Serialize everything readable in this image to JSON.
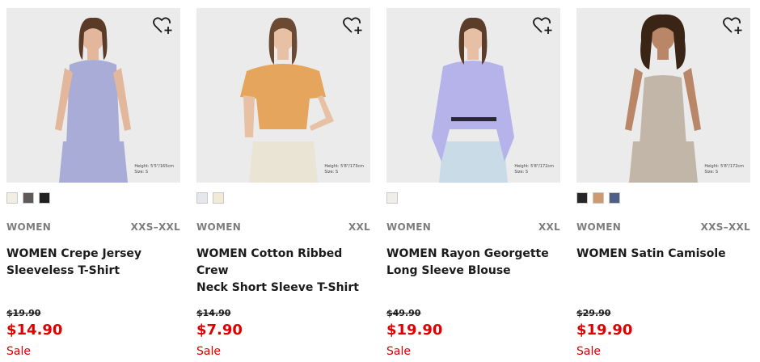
{
  "products": [
    {
      "gender": "WOMEN",
      "size_range": "XXS–XXL",
      "name_lines": [
        "WOMEN Crepe Jersey",
        "Sleeveless T-Shirt"
      ],
      "original_price": "$19.90",
      "price": "$14.90",
      "flag": "Sale",
      "model_info": [
        "Height: 5'5\"/165cm",
        "Size: S"
      ],
      "swatches": [
        "#f1eee6",
        "#5e5a5a",
        "#1f1f1f"
      ],
      "photo": {
        "bg": "#ebebeb",
        "garment": "#a9acd6",
        "pants": "#a9acd6",
        "skin": "#e3b79c",
        "hair": "#5a3b27"
      }
    },
    {
      "gender": "WOMEN",
      "size_range": "XXL",
      "name_lines": [
        "WOMEN Cotton Ribbed Crew",
        "Neck Short Sleeve T-Shirt"
      ],
      "original_price": "$14.90",
      "price": "$7.90",
      "flag": "Sale",
      "model_info": [
        "Height: 5'8\"/173cm",
        "Size: S"
      ],
      "swatches": [
        "#e6e6ee",
        "#f1ead6"
      ],
      "photo": {
        "bg": "#ebebeb",
        "garment": "#e6a55c",
        "pants": "#e9e4d3",
        "skin": "#e8c0a3",
        "hair": "#6b4a33"
      }
    },
    {
      "gender": "WOMEN",
      "size_range": "XXL",
      "name_lines": [
        "WOMEN Rayon Georgette",
        "Long Sleeve Blouse"
      ],
      "original_price": "$49.90",
      "price": "$19.90",
      "flag": "Sale",
      "model_info": [
        "Height: 5'8\"/172cm",
        "Size: S"
      ],
      "swatches": [
        "#f0eee8"
      ],
      "photo": {
        "bg": "#ebebeb",
        "garment": "#b5b3ea",
        "pants": "#c8dbe6",
        "skin": "#e6bfa5",
        "hair": "#5b3d2a"
      }
    },
    {
      "gender": "WOMEN",
      "size_range": "XXS–XXL",
      "name_lines": [
        "WOMEN Satin Camisole"
      ],
      "original_price": "$29.90",
      "price": "$19.90",
      "flag": "Sale",
      "model_info": [
        "Height: 5'8\"/172cm",
        "Size: S"
      ],
      "swatches": [
        "#262626",
        "#d09a70",
        "#4e5e86"
      ],
      "photo": {
        "bg": "#ebebeb",
        "garment": "#c2b6a9",
        "pants": "#c2b6a9",
        "skin": "#b98667",
        "hair": "#3a2416"
      }
    }
  ],
  "icons": {
    "favorite": "heart-plus-icon"
  }
}
